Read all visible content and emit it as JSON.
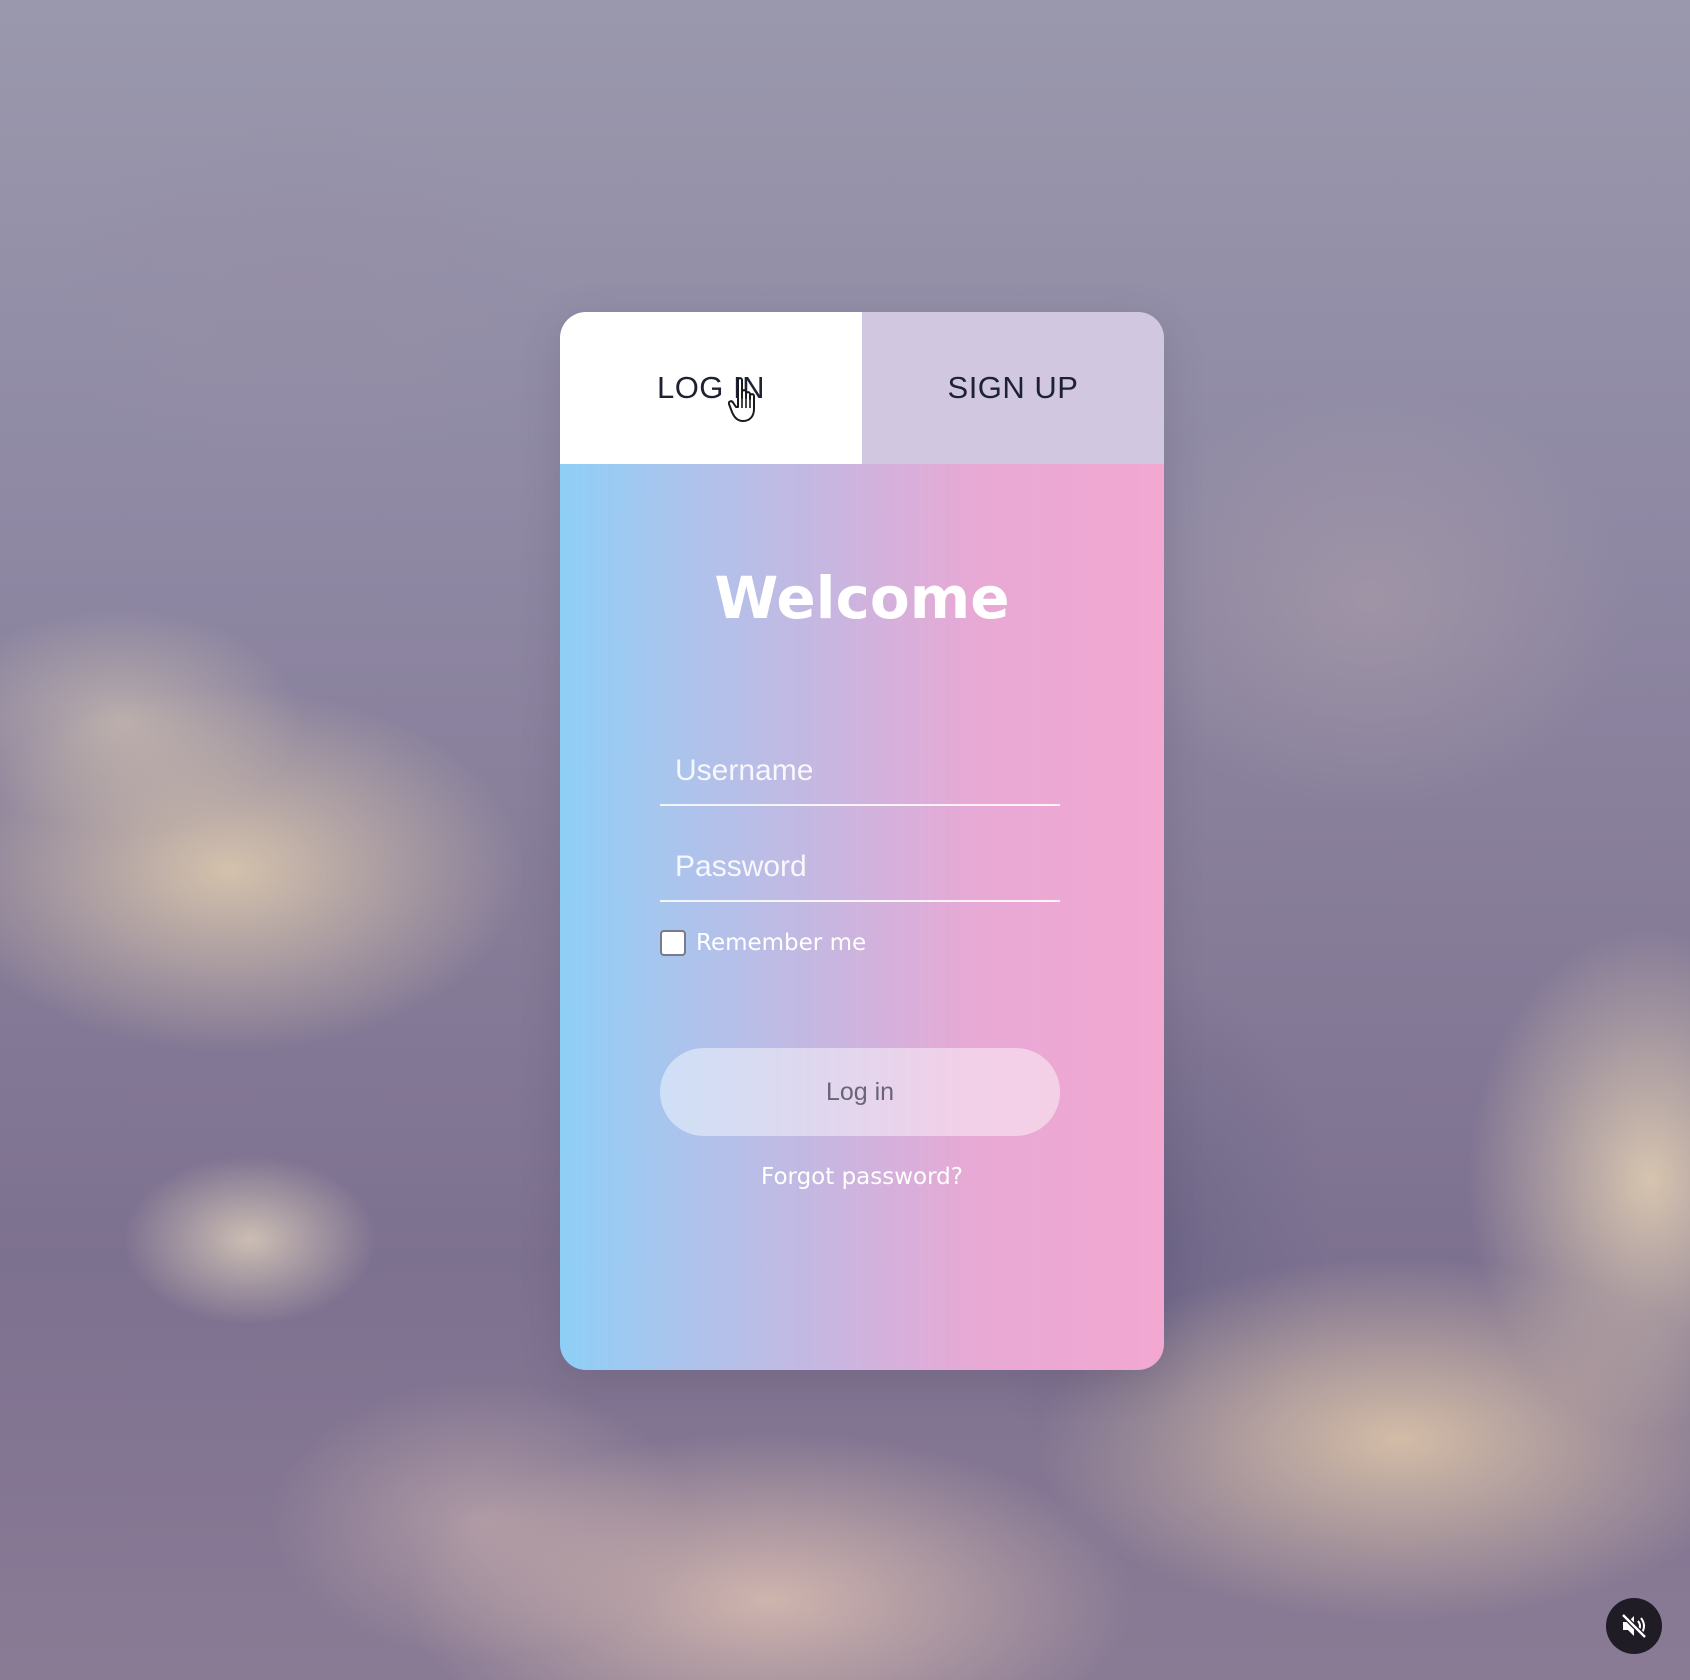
{
  "tabs": {
    "login_label": "LOG IN",
    "signup_label": "SIGN UP",
    "active": "login"
  },
  "form": {
    "title": "Welcome",
    "username_placeholder": "Username",
    "password_placeholder": "Password",
    "remember_label": "Remember me",
    "remember_checked": false,
    "submit_label": "Log in",
    "forgot_label": "Forgot password?"
  },
  "colors": {
    "gradient_start": "#8ecff7",
    "gradient_mid": "#c8b6e0",
    "gradient_end": "#f2a8d1",
    "active_tab": "#ffffff",
    "inactive_tab": "#d2c7e1"
  },
  "overlay": {
    "cursor_icon": "hand-pointer-icon",
    "mute_icon": "speaker-muted-icon"
  }
}
